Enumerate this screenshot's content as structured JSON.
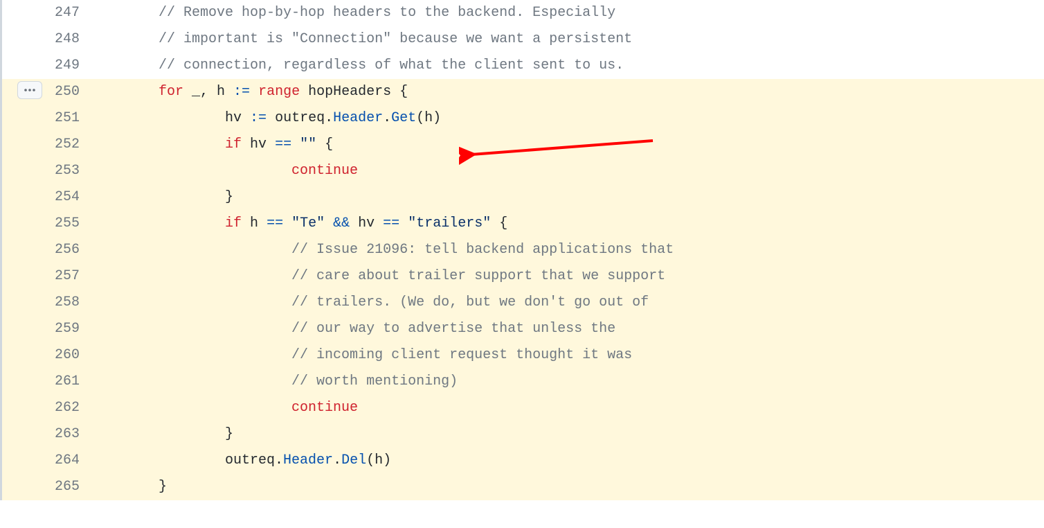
{
  "lines": [
    {
      "num": "247",
      "hl": false,
      "tokens": [
        {
          "cls": "c",
          "t": "\t\t// Remove hop-by-hop headers to the backend. Especially"
        }
      ]
    },
    {
      "num": "248",
      "hl": false,
      "tokens": [
        {
          "cls": "c",
          "t": "\t\t// important is \"Connection\" because we want a persistent"
        }
      ]
    },
    {
      "num": "249",
      "hl": false,
      "tokens": [
        {
          "cls": "c",
          "t": "\t\t// connection, regardless of what the client sent to us."
        }
      ]
    },
    {
      "num": "250",
      "hl": true,
      "tokens": [
        {
          "cls": "n",
          "t": "\t\t"
        },
        {
          "cls": "k",
          "t": "for"
        },
        {
          "cls": "n",
          "t": " _, h "
        },
        {
          "cls": "o",
          "t": ":="
        },
        {
          "cls": "n",
          "t": " "
        },
        {
          "cls": "k",
          "t": "range"
        },
        {
          "cls": "n",
          "t": " hopHeaders {"
        }
      ]
    },
    {
      "num": "251",
      "hl": true,
      "tokens": [
        {
          "cls": "n",
          "t": "\t\t\t\thv "
        },
        {
          "cls": "o",
          "t": ":="
        },
        {
          "cls": "n",
          "t": " outreq."
        },
        {
          "cls": "f",
          "t": "Header"
        },
        {
          "cls": "n",
          "t": "."
        },
        {
          "cls": "f",
          "t": "Get"
        },
        {
          "cls": "n",
          "t": "(h)"
        }
      ]
    },
    {
      "num": "252",
      "hl": true,
      "tokens": [
        {
          "cls": "n",
          "t": "\t\t\t\t"
        },
        {
          "cls": "k",
          "t": "if"
        },
        {
          "cls": "n",
          "t": " hv "
        },
        {
          "cls": "o",
          "t": "=="
        },
        {
          "cls": "n",
          "t": " "
        },
        {
          "cls": "s",
          "t": "\"\""
        },
        {
          "cls": "n",
          "t": " {"
        }
      ]
    },
    {
      "num": "253",
      "hl": true,
      "tokens": [
        {
          "cls": "n",
          "t": "\t\t\t\t\t\t"
        },
        {
          "cls": "k",
          "t": "continue"
        }
      ]
    },
    {
      "num": "254",
      "hl": true,
      "tokens": [
        {
          "cls": "n",
          "t": "\t\t\t\t}"
        }
      ]
    },
    {
      "num": "255",
      "hl": true,
      "tokens": [
        {
          "cls": "n",
          "t": "\t\t\t\t"
        },
        {
          "cls": "k",
          "t": "if"
        },
        {
          "cls": "n",
          "t": " h "
        },
        {
          "cls": "o",
          "t": "=="
        },
        {
          "cls": "n",
          "t": " "
        },
        {
          "cls": "s",
          "t": "\"Te\""
        },
        {
          "cls": "n",
          "t": " "
        },
        {
          "cls": "o",
          "t": "&&"
        },
        {
          "cls": "n",
          "t": " hv "
        },
        {
          "cls": "o",
          "t": "=="
        },
        {
          "cls": "n",
          "t": " "
        },
        {
          "cls": "s",
          "t": "\"trailers\""
        },
        {
          "cls": "n",
          "t": " {"
        }
      ]
    },
    {
      "num": "256",
      "hl": true,
      "tokens": [
        {
          "cls": "c",
          "t": "\t\t\t\t\t\t// Issue 21096: tell backend applications that"
        }
      ]
    },
    {
      "num": "257",
      "hl": true,
      "tokens": [
        {
          "cls": "c",
          "t": "\t\t\t\t\t\t// care about trailer support that we support"
        }
      ]
    },
    {
      "num": "258",
      "hl": true,
      "tokens": [
        {
          "cls": "c",
          "t": "\t\t\t\t\t\t// trailers. (We do, but we don't go out of"
        }
      ]
    },
    {
      "num": "259",
      "hl": true,
      "tokens": [
        {
          "cls": "c",
          "t": "\t\t\t\t\t\t// our way to advertise that unless the"
        }
      ]
    },
    {
      "num": "260",
      "hl": true,
      "tokens": [
        {
          "cls": "c",
          "t": "\t\t\t\t\t\t// incoming client request thought it was"
        }
      ]
    },
    {
      "num": "261",
      "hl": true,
      "tokens": [
        {
          "cls": "c",
          "t": "\t\t\t\t\t\t// worth mentioning)"
        }
      ]
    },
    {
      "num": "262",
      "hl": true,
      "tokens": [
        {
          "cls": "n",
          "t": "\t\t\t\t\t\t"
        },
        {
          "cls": "k",
          "t": "continue"
        }
      ]
    },
    {
      "num": "263",
      "hl": true,
      "tokens": [
        {
          "cls": "n",
          "t": "\t\t\t\t}"
        }
      ]
    },
    {
      "num": "264",
      "hl": true,
      "tokens": [
        {
          "cls": "n",
          "t": "\t\t\t\toutreq."
        },
        {
          "cls": "f",
          "t": "Header"
        },
        {
          "cls": "n",
          "t": "."
        },
        {
          "cls": "f",
          "t": "Del"
        },
        {
          "cls": "n",
          "t": "(h)"
        }
      ]
    },
    {
      "num": "265",
      "hl": true,
      "tokens": [
        {
          "cls": "n",
          "t": "\t\t}"
        }
      ]
    }
  ],
  "arrow": {
    "color": "#ff0000"
  },
  "tab_size": 4
}
